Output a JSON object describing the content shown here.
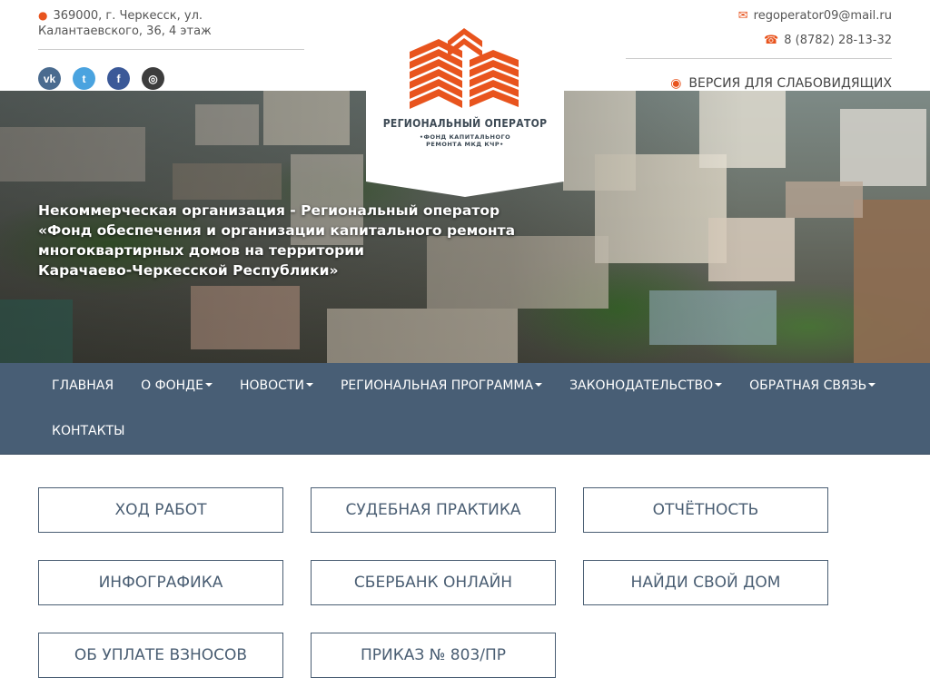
{
  "header": {
    "address": "369000, г. Черкесск, ул. Калантаевского, 36, 4 этаж",
    "email": "regoperator09@mail.ru",
    "phone": "8 (8782) 28-13-32",
    "accessibility_label": "ВЕРСИЯ ДЛЯ СЛАБОВИДЯЩИХ",
    "social": [
      {
        "name": "vk",
        "glyph": "vk"
      },
      {
        "name": "twitter",
        "glyph": "t"
      },
      {
        "name": "facebook",
        "glyph": "f"
      },
      {
        "name": "instagram",
        "glyph": "◎"
      }
    ]
  },
  "logo": {
    "title": "РЕГИОНАЛЬНЫЙ ОПЕРАТОР",
    "subtitle_line1": "•ФОНД КАПИТАЛЬНОГО",
    "subtitle_line2": "РЕМОНТА МКД КЧР•",
    "color": "#e8541e"
  },
  "hero": {
    "title_line1": "Некоммерческая организация - Региональный оператор",
    "title_line2": "«Фонд обеспечения и организации капитального ремонта",
    "title_line3": "многоквартирных домов на территории",
    "title_line4": "Карачаево-Черкесской Республики»"
  },
  "nav": {
    "items": [
      {
        "label": "ГЛАВНАЯ",
        "dropdown": false
      },
      {
        "label": "О ФОНДЕ",
        "dropdown": true
      },
      {
        "label": "НОВОСТИ",
        "dropdown": true
      },
      {
        "label": "РЕГИОНАЛЬНАЯ ПРОГРАММА",
        "dropdown": true
      },
      {
        "label": "ЗАКОНОДАТЕЛЬСТВО",
        "dropdown": true
      },
      {
        "label": "ОБРАТНАЯ СВЯЗЬ",
        "dropdown": true
      },
      {
        "label": "КОНТАКТЫ",
        "dropdown": false
      }
    ]
  },
  "tiles": [
    {
      "label": "ХОД РАБОТ"
    },
    {
      "label": "СУДЕБНАЯ ПРАКТИКА"
    },
    {
      "label": "ОТЧЁТНОСТЬ"
    },
    {
      "label": "ИНФОГРАФИКА"
    },
    {
      "label": "СБЕРБАНК ОНЛАЙН"
    },
    {
      "label": "НАЙДИ СВОЙ ДОМ"
    },
    {
      "label": "ОБ УПЛАТЕ ВЗНОСОВ"
    },
    {
      "label": "ПРИКАЗ № 803/ПР"
    }
  ],
  "colors": {
    "accent": "#e8541e",
    "nav_bg": "#485e75",
    "tile_border": "#4a5e73"
  }
}
